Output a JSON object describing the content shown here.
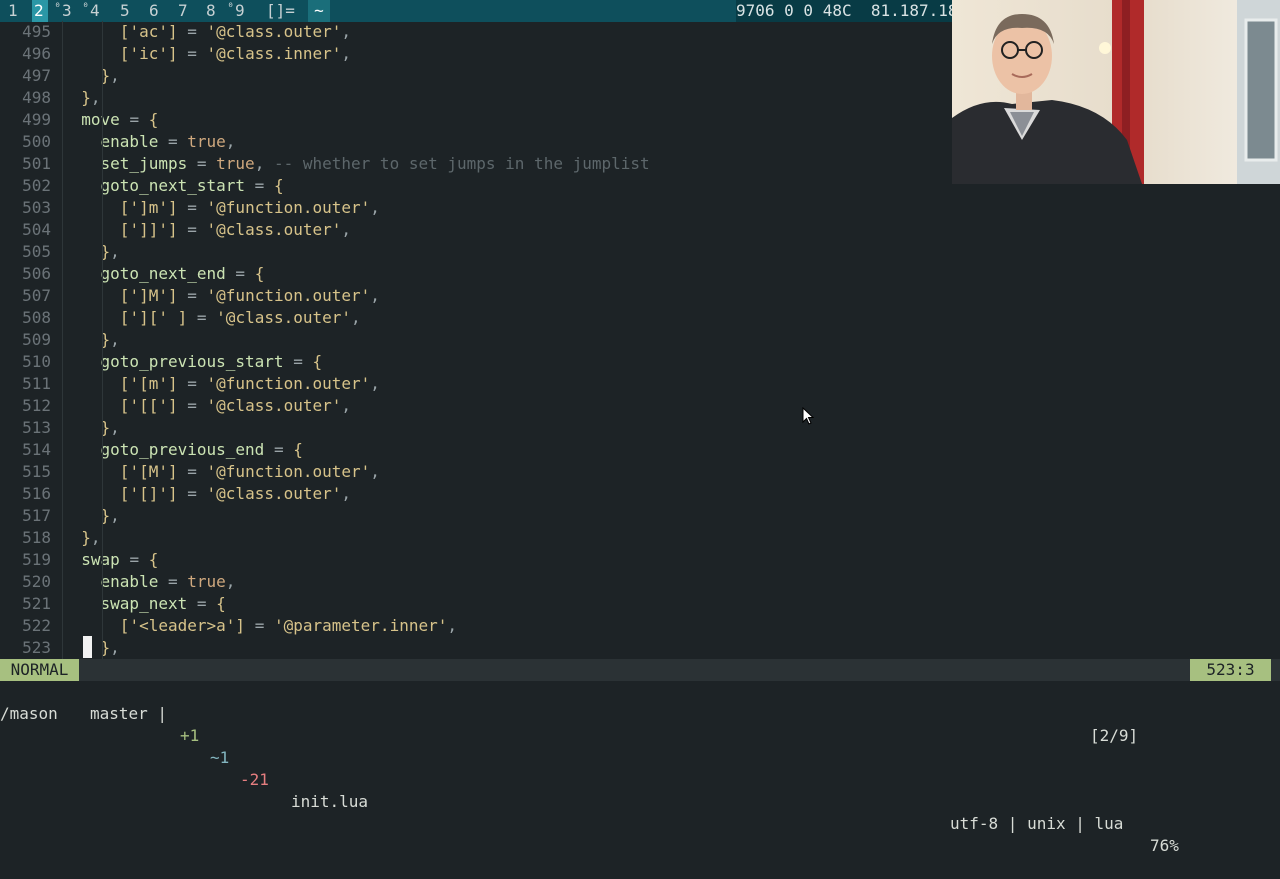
{
  "tmux": {
    "windows": [
      "1",
      "2",
      "3",
      "4",
      "5",
      "6",
      "7",
      "8",
      "9"
    ],
    "window_marks": [
      "",
      "",
      "⁰",
      "⁰",
      "",
      "",
      "",
      "",
      "⁰"
    ],
    "active_index": 1,
    "layout": "[]=",
    "session": "~",
    "stats": "9706 0 0 48C  81.187.18"
  },
  "editor": {
    "lines": [
      {
        "n": "495",
        "code": "      ['ac'] = '@class.outer',"
      },
      {
        "n": "496",
        "code": "      ['ic'] = '@class.inner',"
      },
      {
        "n": "497",
        "code": "    },"
      },
      {
        "n": "498",
        "code": "  },"
      },
      {
        "n": "499",
        "code": "  move = {"
      },
      {
        "n": "500",
        "code": "    enable = true,"
      },
      {
        "n": "501",
        "code": "    set_jumps = true, -- whether to set jumps in the jumplist"
      },
      {
        "n": "502",
        "code": "    goto_next_start = {"
      },
      {
        "n": "503",
        "code": "      [']m'] = '@function.outer',"
      },
      {
        "n": "504",
        "code": "      [']]'] = '@class.outer',"
      },
      {
        "n": "505",
        "code": "    },"
      },
      {
        "n": "506",
        "code": "    goto_next_end = {"
      },
      {
        "n": "507",
        "code": "      [']M'] = '@function.outer',"
      },
      {
        "n": "508",
        "code": "      ['][' ] = '@class.outer',"
      },
      {
        "n": "509",
        "code": "    },"
      },
      {
        "n": "510",
        "code": "    goto_previous_start = {"
      },
      {
        "n": "511",
        "code": "      ['[m'] = '@function.outer',"
      },
      {
        "n": "512",
        "code": "      ['[['] = '@class.outer',"
      },
      {
        "n": "513",
        "code": "    },"
      },
      {
        "n": "514",
        "code": "    goto_previous_end = {"
      },
      {
        "n": "515",
        "code": "      ['[M'] = '@function.outer',"
      },
      {
        "n": "516",
        "code": "      ['[]'] = '@class.outer',"
      },
      {
        "n": "517",
        "code": "    },"
      },
      {
        "n": "518",
        "code": "  },"
      },
      {
        "n": "519",
        "code": "  swap = {"
      },
      {
        "n": "520",
        "code": "    enable = true,"
      },
      {
        "n": "521",
        "code": "    swap_next = {"
      },
      {
        "n": "522",
        "code": "      ['<leader>a'] = '@parameter.inner',"
      },
      {
        "n": "523",
        "code": "    },"
      }
    ]
  },
  "statusline": {
    "mode": "NORMAL",
    "branch": "master |",
    "diff_add": "+1",
    "diff_mod": "~1",
    "diff_del": "-21",
    "filename": "init.lua",
    "fileinfo": "utf-8 | unix | lua",
    "percent": "76%",
    "position": "523:3"
  },
  "cmdline": {
    "text": "/mason",
    "search_count": "[2/9]"
  },
  "colors": {
    "background": "#1d2326",
    "tmux_bar": "#0e4f5c",
    "mode_accent": "#a7c080",
    "string": "#d7c38a",
    "key": "#cbe3b3"
  },
  "icons": {
    "mouse": "mouse-pointer-icon"
  }
}
